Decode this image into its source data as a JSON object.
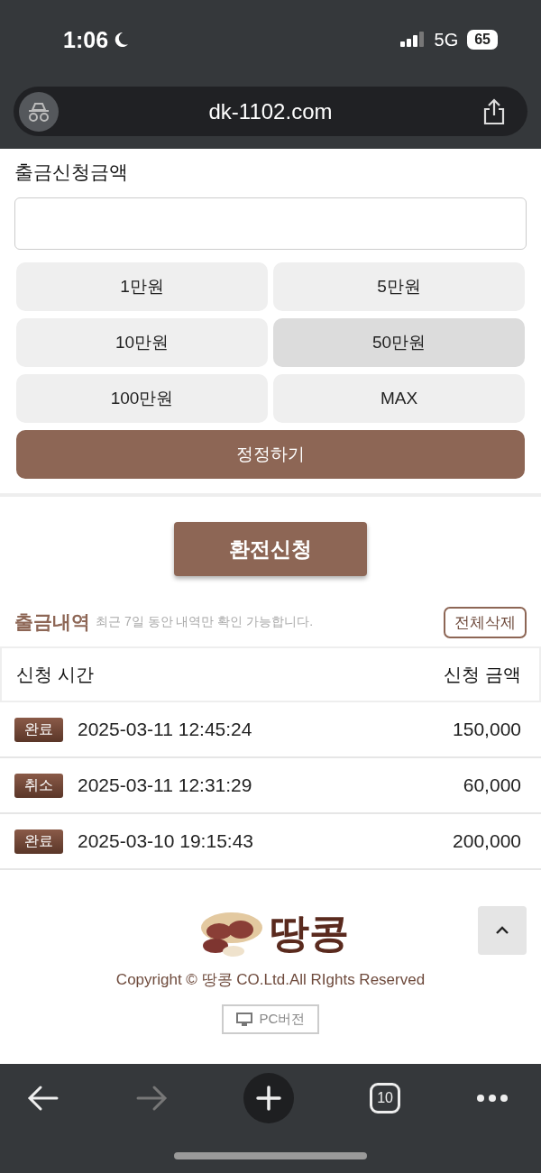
{
  "status_bar": {
    "time": "1:06",
    "network": "5G",
    "battery": "65"
  },
  "browser": {
    "url": "dk-1102.com",
    "tabs_count": "10"
  },
  "form": {
    "label": "출금신청금액",
    "amounts": [
      {
        "label": "1만원",
        "selected": false
      },
      {
        "label": "5만원",
        "selected": false
      },
      {
        "label": "10만원",
        "selected": false
      },
      {
        "label": "50만원",
        "selected": true
      },
      {
        "label": "100만원",
        "selected": false
      },
      {
        "label": "MAX",
        "selected": false
      }
    ],
    "reset_button": "정정하기",
    "submit_button": "환전신청"
  },
  "history": {
    "title": "출금내역",
    "note": "최근 7일 동안 내역만 확인 가능합니다.",
    "delete_all": "전체삭제",
    "columns": [
      "신청 시간",
      "신청 금액"
    ],
    "rows": [
      {
        "status": "완료",
        "time": "2025-03-11 12:45:24",
        "amount": "150,000"
      },
      {
        "status": "취소",
        "time": "2025-03-11 12:31:29",
        "amount": "60,000"
      },
      {
        "status": "완료",
        "time": "2025-03-10 19:15:43",
        "amount": "200,000"
      }
    ]
  },
  "footer": {
    "logo": "땅콩",
    "copyright": "Copyright © 땅콩 CO.Ltd.All RIghts Reserved",
    "pc_button": "PC버전"
  }
}
